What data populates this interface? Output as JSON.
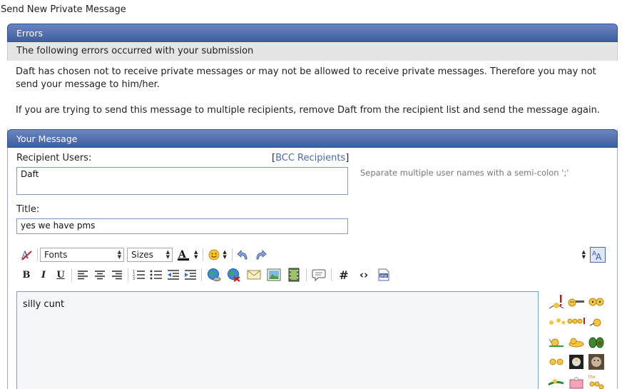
{
  "page": {
    "title": "Send New Private Message"
  },
  "errors": {
    "header": "Errors",
    "subheader": "The following errors occurred with your submission",
    "message1": "Daft has chosen not to receive private messages or may not be allowed to receive private messages. Therefore you may not send your message to him/her.",
    "message2": "If you are trying to send this message to multiple recipients, remove Daft from the recipient list and send the message again."
  },
  "message": {
    "header": "Your Message",
    "recipient_label": "Recipient Users:",
    "bcc_open": "[",
    "bcc_link": "BCC Recipients",
    "bcc_close": "]",
    "recipient_value": "Daft",
    "recipient_hint": "Separate multiple user names with a semi-colon ';'",
    "title_label": "Title:",
    "title_value": "yes we have pms",
    "body": "silly cunt"
  },
  "toolbar": {
    "font_select": "Fonts",
    "size_select": "Sizes"
  },
  "colors": {
    "header_bg": "#4f6dad",
    "accent": "#4a6aa5"
  }
}
